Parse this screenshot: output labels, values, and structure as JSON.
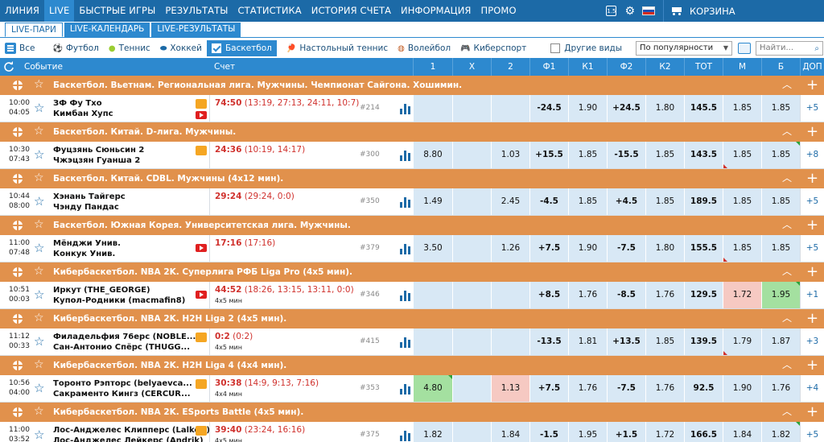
{
  "nav": {
    "items": [
      "ЛИНИЯ",
      "LIVE",
      "БЫСТРЫЕ ИГРЫ",
      "РЕЗУЛЬТАТЫ",
      "СТАТИСТИКА",
      "ИСТОРИЯ СЧЕТА",
      "ИНФОРМАЦИЯ",
      "ПРОМО"
    ],
    "active": "LIVE",
    "badge": "1.5",
    "cart_label": "КОРЗИНА"
  },
  "subtabs": {
    "items": [
      "LIVE-ПАРИ",
      "LIVE-КАЛЕНДАРЬ",
      "LIVE-РЕЗУЛЬТАТЫ"
    ],
    "active": "LIVE-ПАРИ"
  },
  "filters": {
    "all": "Все",
    "sports": [
      "Футбол",
      "Теннис",
      "Хоккей",
      "Баскетбол",
      "Настольный теннис",
      "Волейбол",
      "Киберспорт"
    ],
    "selected": "Баскетбол",
    "other": "Другие виды",
    "sort": "По популярности",
    "search_placeholder": "Найти..."
  },
  "columns": {
    "event": "Событие",
    "score": "Счет",
    "odds": [
      "1",
      "X",
      "2",
      "Ф1",
      "К1",
      "Ф2",
      "К2",
      "ТОТ",
      "М",
      "Б",
      "ДОП"
    ]
  },
  "colors": {
    "nav": "#1c6aa7",
    "header": "#2d89cf",
    "league": "#e1914c",
    "odds_cell": "#d8e8f5",
    "up": "#a4e0a0",
    "down": "#f6c9c2",
    "score": "#d0312d"
  },
  "rows": [
    {
      "league": "Баскетбол. Вьетнам. Региональная лига. Мужчины. Чемпионат Сайгона. Хошимин.",
      "time": "10:00",
      "time2": "04:05",
      "team1": "ЗФ Фу Тхо",
      "team2": "Кимбан Хупс",
      "score": "74:50",
      "periods": "(13:19, 27:13, 24:11, 10:7)",
      "sub": "",
      "id": "#214",
      "odds": [
        "",
        "",
        "",
        "-24.5",
        "1.90",
        "+24.5",
        "1.80",
        "145.5",
        "1.85",
        "1.85",
        "+5"
      ]
    },
    {
      "league": "Баскетбол. Китай. D-лига. Мужчины.",
      "time": "10:30",
      "time2": "07:43",
      "team1": "Фуцзянь Сюньсин 2",
      "team2": "Чжэцзян Гуанша 2",
      "score": "24:36",
      "periods": "(10:19, 14:17)",
      "sub": "",
      "id": "#300",
      "odds": [
        "8.80",
        "",
        "1.03",
        "+15.5",
        "1.85",
        "-15.5",
        "1.85",
        "143.5",
        "1.85",
        "1.85",
        "+8"
      ]
    },
    {
      "league": "Баскетбол. Китай. CDBL. Мужчины (4x12 мин).",
      "time": "10:44",
      "time2": "08:00",
      "team1": "Хэнань Тайгерс",
      "team2": "Чэнду Пандас",
      "score": "29:24",
      "periods": "(29:24, 0:0)",
      "sub": "",
      "id": "#350",
      "odds": [
        "1.49",
        "",
        "2.45",
        "-4.5",
        "1.85",
        "+4.5",
        "1.85",
        "189.5",
        "1.85",
        "1.85",
        "+5"
      ]
    },
    {
      "league": "Баскетбол. Южная Корея. Университетская лига. Мужчины.",
      "time": "11:00",
      "time2": "07:48",
      "team1": "Мёнджи Унив.",
      "team2": "Конкук Унив.",
      "score": "17:16",
      "periods": "(17:16)",
      "sub": "",
      "id": "#379",
      "odds": [
        "3.50",
        "",
        "1.26",
        "+7.5",
        "1.90",
        "-7.5",
        "1.80",
        "155.5",
        "1.85",
        "1.85",
        "+5"
      ]
    },
    {
      "league": "Кибербаскетбол. NBA 2K. Суперлига РФБ Liga Pro (4x5 мин).",
      "time": "10:51",
      "time2": "00:03",
      "team1": "Иркут (THE_GEORGE)",
      "team2": "Купол-Родники (macmafin8)",
      "score": "44:52",
      "periods": "(18:26, 13:15, 13:11, 0:0)",
      "sub": "4x5 мин",
      "id": "#346",
      "odds": [
        "",
        "",
        "",
        "+8.5",
        "1.76",
        "-8.5",
        "1.76",
        "129.5",
        "1.72",
        "1.95",
        "+1"
      ]
    },
    {
      "league": "Кибербаскетбол. NBA 2K. H2H Liga 2 (4x5 мин).",
      "time": "11:12",
      "time2": "00:33",
      "team1": "Филадельфия 76ерс (NOBLE...",
      "team2": "Сан-Антонио Спёрс (THUGG...",
      "score": "0:2",
      "periods": "(0:2)",
      "sub": "4x5 мин",
      "id": "#415",
      "odds": [
        "",
        "",
        "",
        "-13.5",
        "1.81",
        "+13.5",
        "1.85",
        "139.5",
        "1.79",
        "1.87",
        "+3"
      ]
    },
    {
      "league": "Кибербаскетбол. NBA 2K. H2H Liga 4 (4x4 мин).",
      "time": "10:56",
      "time2": "04:00",
      "team1": "Торонто Рэпторс (belyaevca...",
      "team2": "Сакраменто Кингз (CERCUR...",
      "score": "30:38",
      "periods": "(14:9, 9:13, 7:16)",
      "sub": "4x4 мин",
      "id": "#353",
      "odds": [
        "4.80",
        "",
        "1.13",
        "+7.5",
        "1.76",
        "-7.5",
        "1.76",
        "92.5",
        "1.90",
        "1.76",
        "+4"
      ]
    },
    {
      "league": "Кибербаскетбол. NBA 2K. ESports Battle (4x5 мин).",
      "time": "11:00",
      "time2": "03:52",
      "team1": "Лос-Анджелес Клипперс (Lalkoff)",
      "team2": "Лос-Анджелес Лейкерс (Andrik)",
      "score": "39:40",
      "periods": "(23:24, 16:16)",
      "sub": "4x5 мин",
      "id": "#375",
      "odds": [
        "1.82",
        "",
        "1.84",
        "-1.5",
        "1.95",
        "+1.5",
        "1.72",
        "166.5",
        "1.84",
        "1.82",
        "+5"
      ]
    }
  ]
}
